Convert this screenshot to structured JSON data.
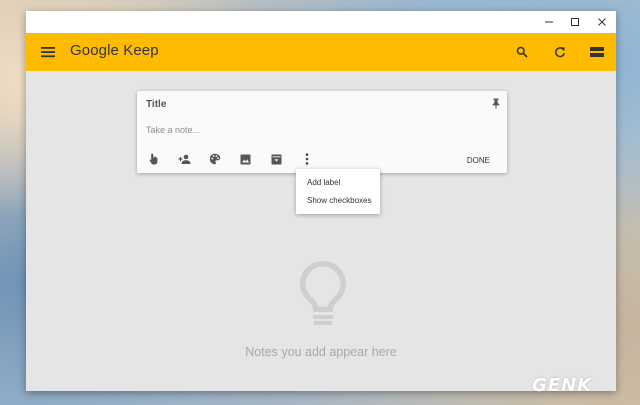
{
  "window": {
    "controls": {
      "minimize_icon": "minimize-icon",
      "maximize_icon": "maximize-icon",
      "close_icon": "close-icon"
    }
  },
  "appbar": {
    "app_name": "Google Keep",
    "color": "#ffbb00",
    "icons": [
      "menu-icon",
      "search-icon",
      "refresh-icon",
      "list-view-icon"
    ]
  },
  "note": {
    "title": "Title",
    "placeholder": "Take a note...",
    "toolbar_icons": [
      "remind-me-icon",
      "collaborator-icon",
      "palette-icon",
      "image-icon",
      "archive-icon",
      "more-vert-icon"
    ],
    "done_label": "DONE"
  },
  "menu": {
    "items": [
      "Add label",
      "Show checkboxes"
    ]
  },
  "empty_state": {
    "icon": "lightbulb-icon",
    "text": "Notes you add appear here"
  },
  "watermark": "GENK"
}
